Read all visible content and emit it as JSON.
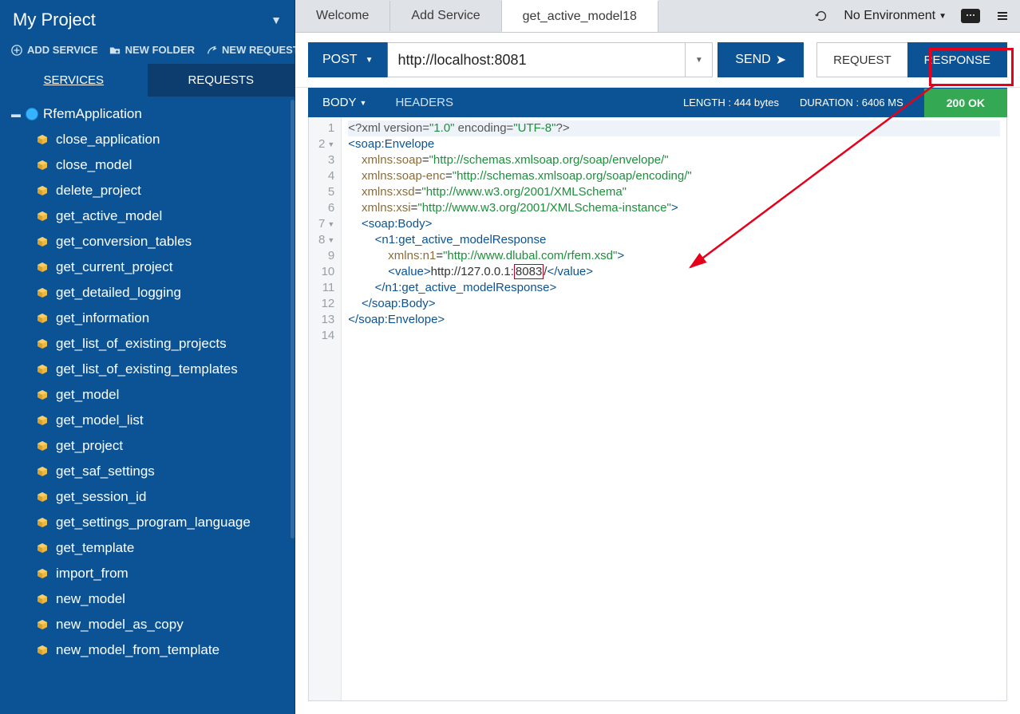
{
  "sidebar": {
    "title": "My Project",
    "actions": {
      "add_service": "ADD SERVICE",
      "new_folder": "NEW FOLDER",
      "new_request": "NEW REQUEST"
    },
    "tabs": {
      "services": "SERVICES",
      "requests": "REQUESTS"
    },
    "root_name": "RfemApplication",
    "items": [
      "close_application",
      "close_model",
      "delete_project",
      "get_active_model",
      "get_conversion_tables",
      "get_current_project",
      "get_detailed_logging",
      "get_information",
      "get_list_of_existing_projects",
      "get_list_of_existing_templates",
      "get_model",
      "get_model_list",
      "get_project",
      "get_saf_settings",
      "get_session_id",
      "get_settings_program_language",
      "get_template",
      "import_from",
      "new_model",
      "new_model_as_copy",
      "new_model_from_template"
    ]
  },
  "tabs": [
    "Welcome",
    "Add Service",
    "get_active_model18"
  ],
  "env_label": "No Environment",
  "request": {
    "method": "POST",
    "url": "http://localhost:8081",
    "send": "SEND",
    "req_btn": "REQUEST",
    "resp_btn": "RESPONSE"
  },
  "response_header": {
    "body": "BODY",
    "headers": "HEADERS",
    "length": "LENGTH : 444 bytes",
    "duration": "DURATION : 6406 MS",
    "status": "200 OK"
  },
  "response_body": {
    "port_highlight": "8083",
    "lines": [
      {
        "n": 1,
        "html": "<span class='decl'>&lt;?xml version=</span><span class='str'>\"1.0\"</span><span class='decl'> encoding=</span><span class='str'>\"UTF-8\"</span><span class='decl'>?&gt;</span>",
        "fold": false
      },
      {
        "n": 2,
        "html": "<span class='tag'>&lt;soap:Envelope</span>",
        "fold": true
      },
      {
        "n": 3,
        "html": "    <span class='attr'>xmlns:soap</span>=<span class='str'>\"http://schemas.xmlsoap.org/soap/envelope/\"</span>",
        "fold": false
      },
      {
        "n": 4,
        "html": "    <span class='attr'>xmlns:soap-enc</span>=<span class='str'>\"http://schemas.xmlsoap.org/soap/encoding/\"</span>",
        "fold": false
      },
      {
        "n": 5,
        "html": "    <span class='attr'>xmlns:xsd</span>=<span class='str'>\"http://www.w3.org/2001/XMLSchema\"</span>",
        "fold": false
      },
      {
        "n": 6,
        "html": "    <span class='attr'>xmlns:xsi</span>=<span class='str'>\"http://www.w3.org/2001/XMLSchema-instance\"</span><span class='tag'>&gt;</span>",
        "fold": false
      },
      {
        "n": 7,
        "html": "    <span class='tag'>&lt;soap:Body&gt;</span>",
        "fold": true
      },
      {
        "n": 8,
        "html": "        <span class='tag'>&lt;n1:get_active_modelResponse</span>",
        "fold": true
      },
      {
        "n": 9,
        "html": "            <span class='attr'>xmlns:n1</span>=<span class='str'>\"http://www.dlubal.com/rfem.xsd\"</span><span class='tag'>&gt;</span>",
        "fold": false
      },
      {
        "n": 10,
        "html": "            <span class='tag'>&lt;value&gt;</span>http://127.0.0.1:<span class='box8083'>8083</span>/<span class='tag'>&lt;/value&gt;</span>",
        "fold": false
      },
      {
        "n": 11,
        "html": "        <span class='tag'>&lt;/n1:get_active_modelResponse&gt;</span>",
        "fold": false
      },
      {
        "n": 12,
        "html": "    <span class='tag'>&lt;/soap:Body&gt;</span>",
        "fold": false
      },
      {
        "n": 13,
        "html": "<span class='tag'>&lt;/soap:Envelope&gt;</span>",
        "fold": false
      },
      {
        "n": 14,
        "html": "",
        "fold": false
      }
    ]
  }
}
